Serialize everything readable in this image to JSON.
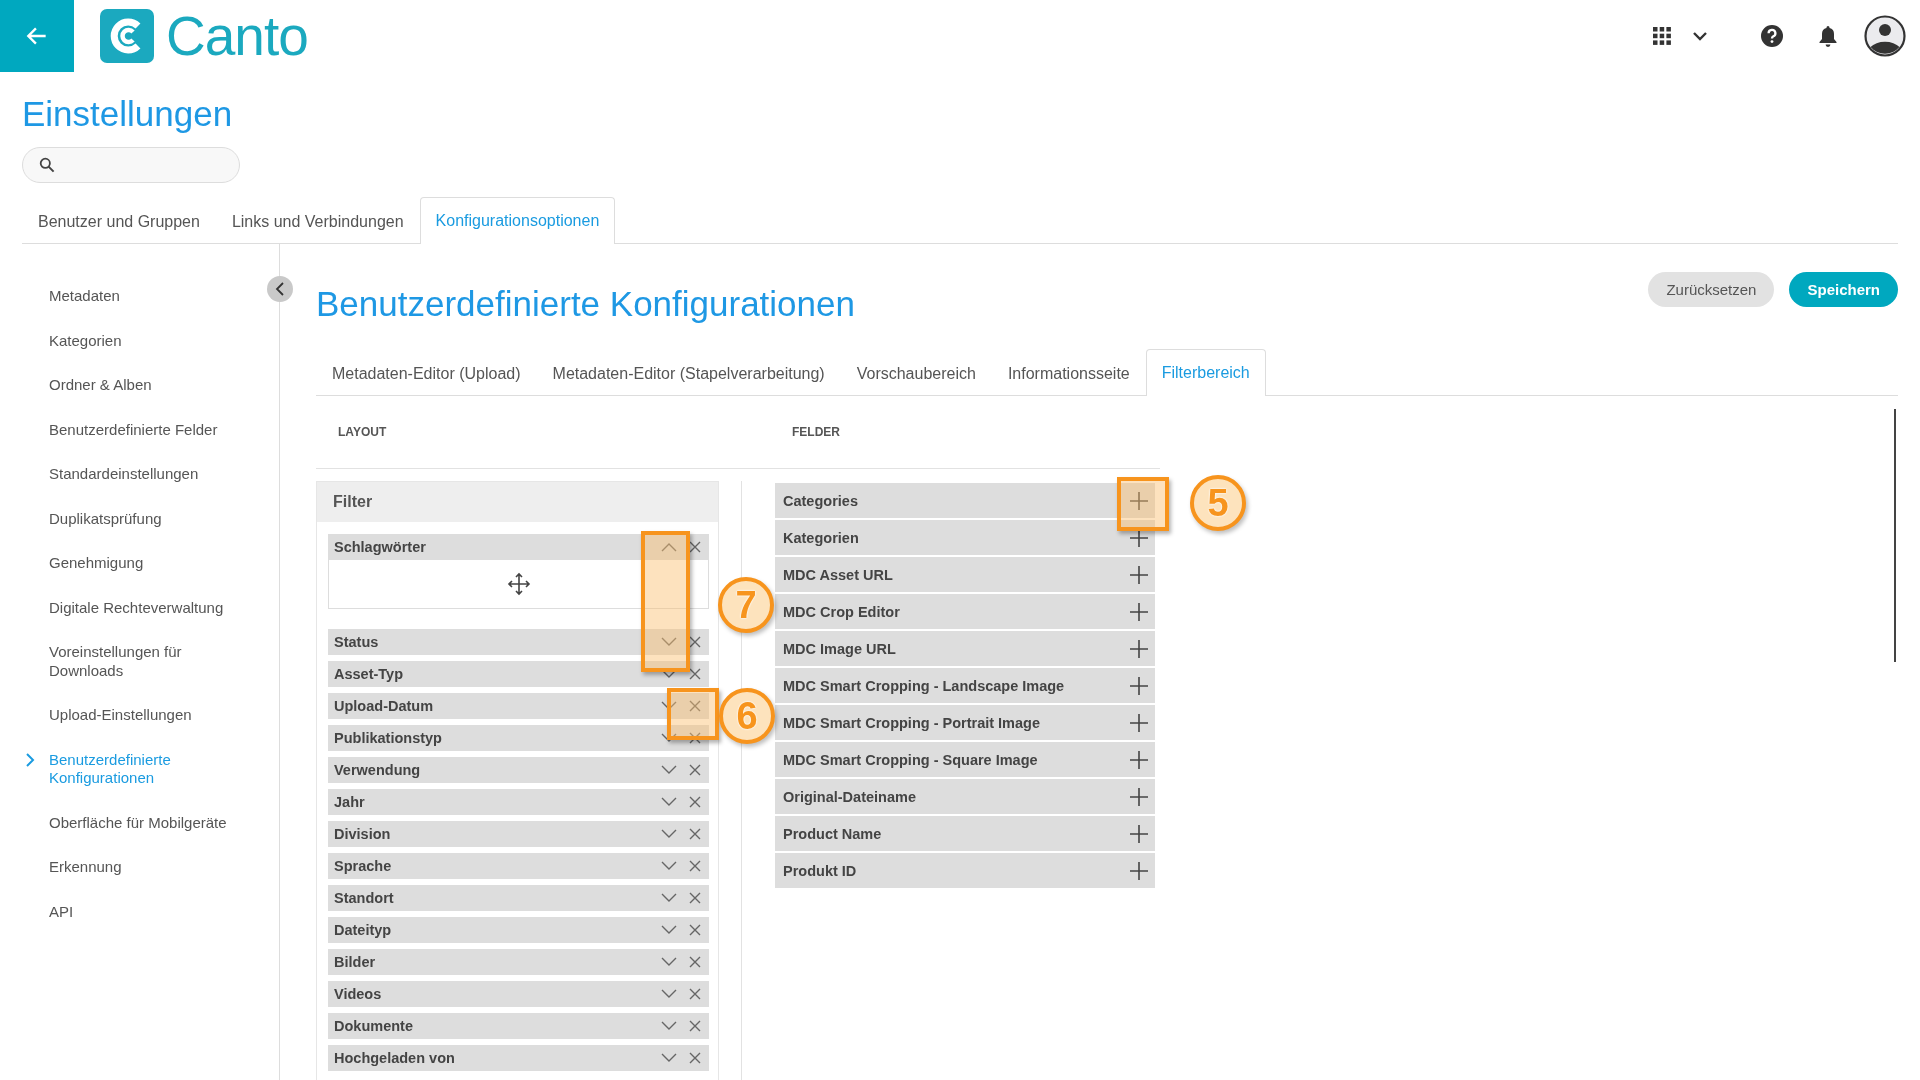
{
  "header": {
    "logo_text": "Canto"
  },
  "page_title": "Einstellungen",
  "tabs": [
    {
      "label": "Benutzer und Gruppen",
      "selected": false
    },
    {
      "label": "Links und Verbindungen",
      "selected": false
    },
    {
      "label": "Konfigurationsoptionen",
      "selected": true
    }
  ],
  "sidebar": {
    "items": [
      {
        "label": "Metadaten",
        "selected": false
      },
      {
        "label": "Kategorien",
        "selected": false
      },
      {
        "label": "Ordner & Alben",
        "selected": false
      },
      {
        "label": "Benutzerdefinierte Felder",
        "selected": false
      },
      {
        "label": "Standardeinstellungen",
        "selected": false
      },
      {
        "label": "Duplikatsprüfung",
        "selected": false
      },
      {
        "label": "Genehmigung",
        "selected": false
      },
      {
        "label": "Digitale Rechteverwaltung",
        "selected": false
      },
      {
        "label": "Voreinstellungen für Downloads",
        "selected": false
      },
      {
        "label": "Upload-Einstellungen",
        "selected": false
      },
      {
        "label": "Benutzerdefinierte Konfigurationen",
        "selected": true
      },
      {
        "label": "Oberfläche für Mobilgeräte",
        "selected": false
      },
      {
        "label": "Erkennung",
        "selected": false
      },
      {
        "label": "API",
        "selected": false
      }
    ]
  },
  "content": {
    "title": "Benutzerdefinierte Konfigurationen",
    "buttons": [
      {
        "label": "Zurücksetzen",
        "kind": "secondary"
      },
      {
        "label": "Speichern",
        "kind": "primary"
      }
    ],
    "tabs": [
      {
        "label": "Metadaten-Editor (Upload)",
        "selected": false
      },
      {
        "label": "Metadaten-Editor (Stapelverarbeitung)",
        "selected": false
      },
      {
        "label": "Vorschaubereich",
        "selected": false
      },
      {
        "label": "Informationsseite",
        "selected": false
      },
      {
        "label": "Filterbereich",
        "selected": true
      }
    ],
    "layout_heading": "LAYOUT",
    "fields_heading": "FELDER",
    "filter_panel": {
      "title": "Filter",
      "items": [
        {
          "label": "Schlagwörter",
          "expanded": true
        },
        {
          "label": "Status",
          "expanded": false
        },
        {
          "label": "Asset-Typ",
          "expanded": false
        },
        {
          "label": "Upload-Datum",
          "expanded": false
        },
        {
          "label": "Publikationstyp",
          "expanded": false
        },
        {
          "label": "Verwendung",
          "expanded": false
        },
        {
          "label": "Jahr",
          "expanded": false
        },
        {
          "label": "Division",
          "expanded": false
        },
        {
          "label": "Sprache",
          "expanded": false
        },
        {
          "label": "Standort",
          "expanded": false
        },
        {
          "label": "Dateityp",
          "expanded": false
        },
        {
          "label": "Bilder",
          "expanded": false
        },
        {
          "label": "Videos",
          "expanded": false
        },
        {
          "label": "Dokumente",
          "expanded": false
        },
        {
          "label": "Hochgeladen von",
          "expanded": false
        }
      ]
    },
    "fields": [
      {
        "label": "Categories"
      },
      {
        "label": "Kategorien"
      },
      {
        "label": "MDC Asset URL"
      },
      {
        "label": "MDC Crop Editor"
      },
      {
        "label": "MDC Image URL"
      },
      {
        "label": "MDC Smart Cropping - Landscape Image"
      },
      {
        "label": "MDC Smart Cropping - Portrait Image"
      },
      {
        "label": "MDC Smart Cropping - Square Image"
      },
      {
        "label": "Original-Dateiname"
      },
      {
        "label": "Product Name"
      },
      {
        "label": "Produkt ID"
      }
    ]
  },
  "callouts": [
    {
      "number": "5"
    },
    {
      "number": "6"
    },
    {
      "number": "7"
    }
  ]
}
